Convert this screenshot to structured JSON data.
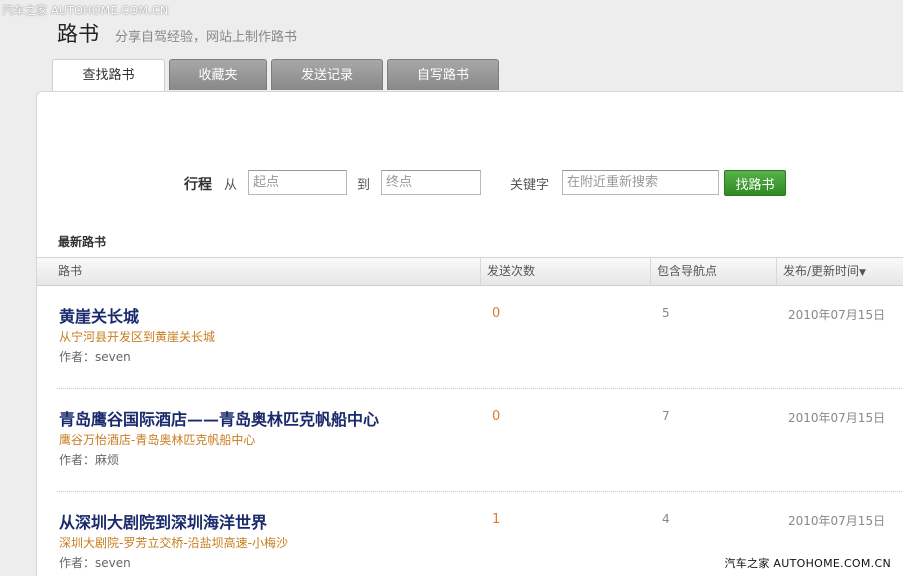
{
  "watermark": {
    "top": "汽车之家 AUTOHOME.COM.CN",
    "bottom": "汽车之家 AUTOHOME.COM.CN"
  },
  "header": {
    "title": "路书",
    "subtitle": "分享自驾经验，网站上制作路书"
  },
  "tabs": [
    {
      "label": "查找路书",
      "active": true
    },
    {
      "label": "收藏夹",
      "active": false
    },
    {
      "label": "发送记录",
      "active": false
    },
    {
      "label": "自写路书",
      "active": false
    }
  ],
  "search": {
    "trip_label": "行程",
    "from_label": "从",
    "start_placeholder": "起点",
    "to_label": "到",
    "end_placeholder": "终点",
    "keyword_label": "关键字",
    "keyword_placeholder": "在附近重新搜索",
    "button_label": "找路书"
  },
  "section_title": "最新路书",
  "table": {
    "headers": {
      "route": "路书",
      "sent": "发送次数",
      "waypoints": "包含导航点",
      "date": "发布/更新时间",
      "sort_icon": "▼"
    },
    "rows": [
      {
        "title": "黄崖关长城",
        "subtitle": "从宁河县开发区到黄崖关长城",
        "author": "作者：seven",
        "sent": "0",
        "waypoints": "5",
        "date": "2010年07月15日"
      },
      {
        "title": "青岛鹰谷国际酒店——青岛奥林匹克帆船中心",
        "subtitle": "鹰谷万怡酒店-青岛奥林匹克帆船中心",
        "author": "作者：麻烦",
        "sent": "0",
        "waypoints": "7",
        "date": "2010年07月15日"
      },
      {
        "title": "从深圳大剧院到深圳海洋世界",
        "subtitle": "深圳大剧院-罗芳立交桥-沿盐坝高速-小梅沙",
        "author": "作者：seven",
        "sent": "1",
        "waypoints": "4",
        "date": "2010年07月15日"
      }
    ]
  }
}
